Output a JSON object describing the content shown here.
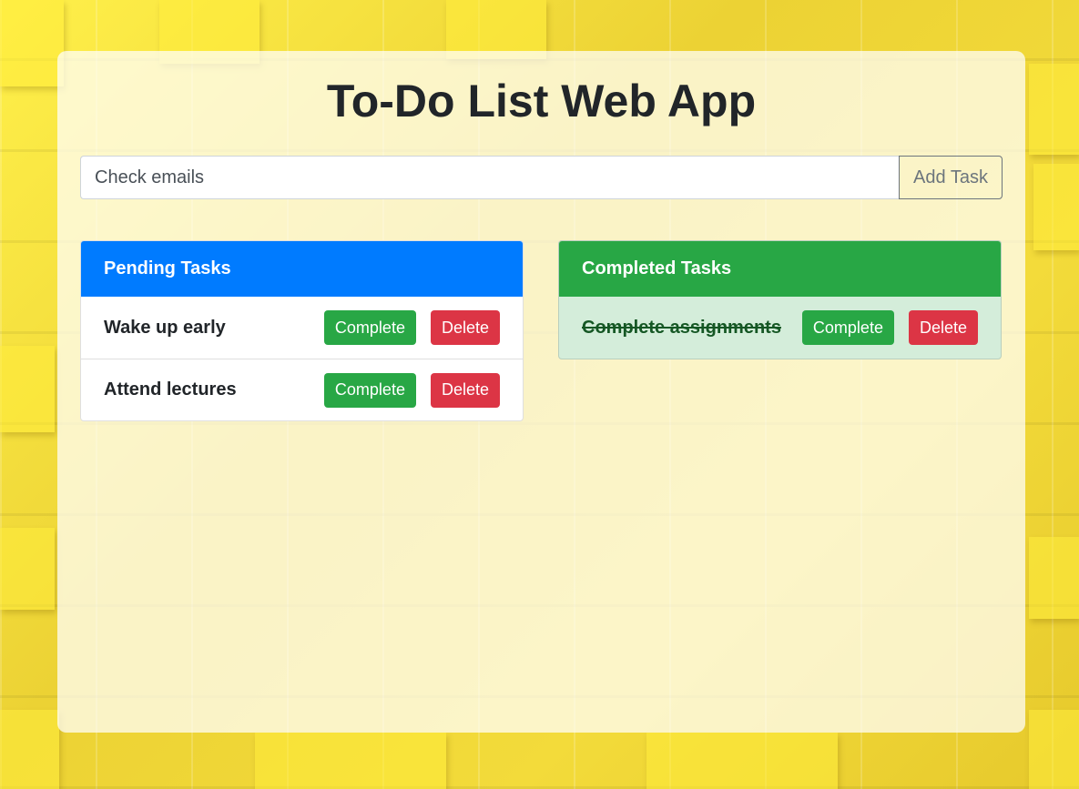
{
  "app": {
    "title": "To-Do List Web App"
  },
  "input": {
    "value": "Check emails",
    "placeholder": "",
    "add_label": "Add Task"
  },
  "pending": {
    "header": "Pending Tasks",
    "tasks": [
      {
        "text": "Wake up early",
        "complete_label": "Complete",
        "delete_label": "Delete"
      },
      {
        "text": "Attend lectures",
        "complete_label": "Complete",
        "delete_label": "Delete"
      }
    ]
  },
  "completed": {
    "header": "Completed Tasks",
    "tasks": [
      {
        "text": "Complete assignments",
        "complete_label": "Complete",
        "delete_label": "Delete"
      }
    ]
  },
  "colors": {
    "primary": "#007bff",
    "success": "#28a745",
    "danger": "#dc3545",
    "completed_bg": "#d4edda",
    "background": "#f2d93a"
  }
}
